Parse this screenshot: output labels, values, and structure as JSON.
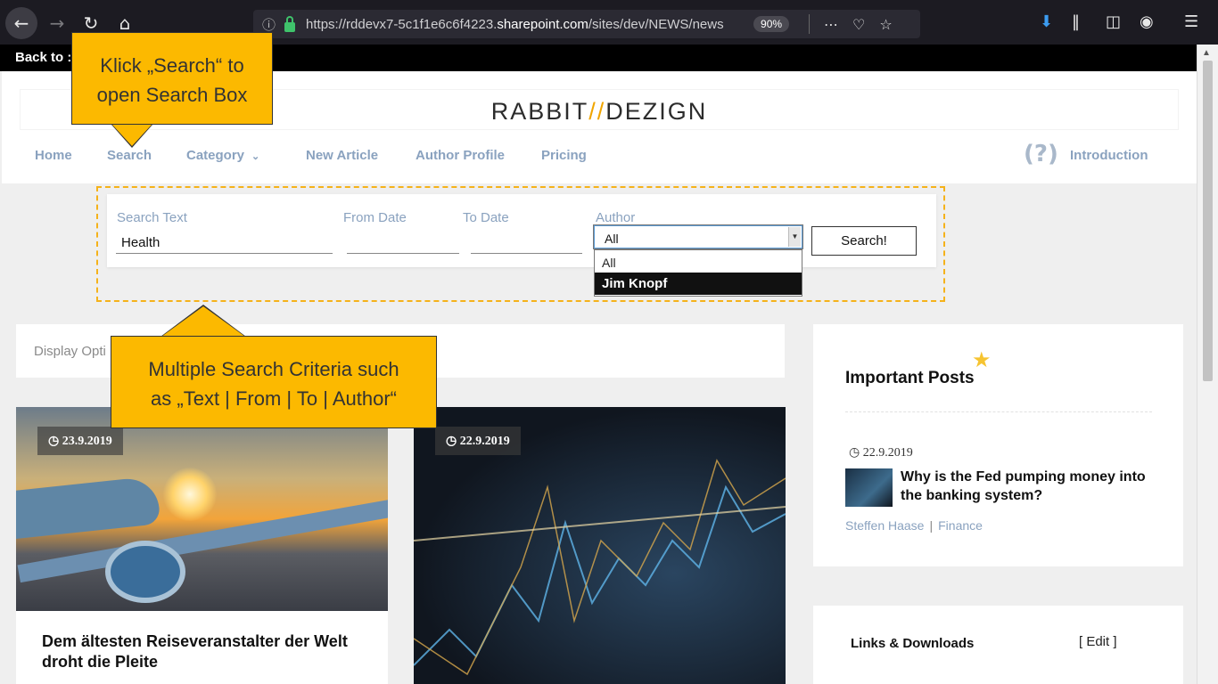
{
  "browser": {
    "url_host": "https://rddevx7-5c1f1e6c6f4223.",
    "url_domain": "sharepoint.com",
    "url_path": "/sites/dev/NEWS/news",
    "zoom": "90%"
  },
  "topbar": {
    "back_label": "Back to :"
  },
  "site": {
    "logo_left": "RABBIT",
    "logo_slash": "//",
    "logo_right": "DEZIGN",
    "nav": {
      "home": "Home",
      "search": "Search",
      "category": "Category",
      "new_article": "New Article",
      "author_profile": "Author Profile",
      "pricing": "Pricing",
      "help_glyph": "(?)",
      "introduction": "Introduction"
    }
  },
  "search": {
    "labels": {
      "text": "Search Text",
      "from": "From Date",
      "to": "To Date",
      "author": "Author"
    },
    "text_value": "Health",
    "author_selected": "All",
    "author_options": [
      "All",
      "Jim Knopf"
    ],
    "button": "Search!"
  },
  "callouts": {
    "search_line1": "Klick „Search“ to",
    "search_line2": "open Search Box",
    "criteria_line1": "Multiple Search Criteria such",
    "criteria_line2": "as „Text | From | To | Author“"
  },
  "content": {
    "display_options": "Display Opti",
    "cards": [
      {
        "date": "23.9.2019",
        "title": "Dem ältesten Reiseveranstalter der Welt droht die Pleite"
      },
      {
        "date": "22.9.2019",
        "title": ""
      }
    ]
  },
  "important_posts": {
    "title": "Important Posts",
    "post": {
      "date": "22.9.2019",
      "title": "Why is the Fed pumping money into the banking system?",
      "author": "Steffen Haase",
      "category": "Finance"
    }
  },
  "links_downloads": {
    "title": "Links & Downloads",
    "edit": "[ Edit ]"
  },
  "colors": {
    "accent": "#fcb900",
    "nav_text": "#8aa2bf",
    "logo_slash": "#f0a500"
  },
  "icons": [
    "back-icon",
    "forward-icon",
    "reload-icon",
    "home-icon",
    "info-icon",
    "lock-icon",
    "more-icon",
    "pocket-icon",
    "bookmark-star-icon",
    "download-icon",
    "library-icon",
    "sidebar-icon",
    "account-icon",
    "menu-icon",
    "clock-icon",
    "star-icon",
    "chevron-down-icon"
  ]
}
